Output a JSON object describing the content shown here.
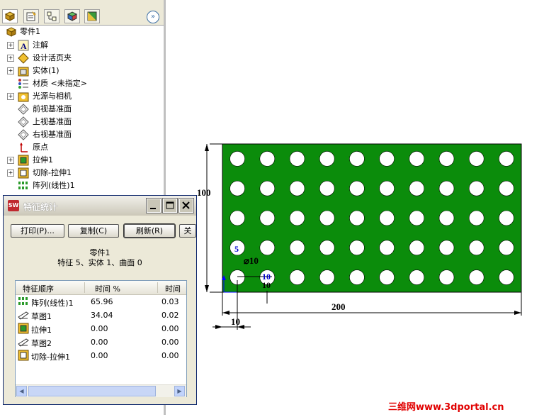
{
  "feature_tree": {
    "root": "零件1",
    "items": [
      {
        "label": "注解",
        "icon": "annotations-icon",
        "expandable": true
      },
      {
        "label": "设计活页夹",
        "icon": "design-binder-icon",
        "expandable": true
      },
      {
        "label": "实体(1)",
        "icon": "solid-bodies-icon",
        "expandable": true
      },
      {
        "label": "材质 <未指定>",
        "icon": "material-icon",
        "expandable": false
      },
      {
        "label": "光源与相机",
        "icon": "lights-cameras-icon",
        "expandable": true
      },
      {
        "label": "前视基准面",
        "icon": "plane-icon",
        "expandable": false
      },
      {
        "label": "上视基准面",
        "icon": "plane-icon",
        "expandable": false
      },
      {
        "label": "右视基准面",
        "icon": "plane-icon",
        "expandable": false
      },
      {
        "label": "原点",
        "icon": "origin-icon",
        "expandable": false
      },
      {
        "label": "拉伸1",
        "icon": "extrude-icon",
        "expandable": true
      },
      {
        "label": "切除-拉伸1",
        "icon": "cut-extrude-icon",
        "expandable": true
      },
      {
        "label": "阵列(线性)1",
        "icon": "linear-pattern-icon",
        "expandable": false
      }
    ]
  },
  "dialog": {
    "title": "特征统计",
    "buttons": {
      "print": "打印(P)...",
      "copy": "复制(C)",
      "refresh": "刷新(R)",
      "close": "关"
    },
    "summary_name": "零件1",
    "summary_stats": "特征 5、实体 1、曲面 0",
    "columns": [
      "特征顺序",
      "时间 %",
      "时间"
    ],
    "rows": [
      {
        "name": "阵列(线性)1",
        "pct": "65.96",
        "time": "0.03",
        "icon": "linear-pattern-icon"
      },
      {
        "name": "草图1",
        "pct": "34.04",
        "time": "0.02",
        "icon": "sketch-icon"
      },
      {
        "name": "拉伸1",
        "pct": "0.00",
        "time": "0.00",
        "icon": "extrude-icon"
      },
      {
        "name": "草图2",
        "pct": "0.00",
        "time": "0.00",
        "icon": "sketch-icon"
      },
      {
        "name": "切除-拉伸1",
        "pct": "0.00",
        "time": "0.00",
        "icon": "cut-extrude-icon"
      }
    ]
  },
  "drawing": {
    "plate_color": "#0b8c0b",
    "hole_rows": 5,
    "hole_cols": 10,
    "dims": {
      "height": "100",
      "width": "200",
      "offset": "10",
      "diameter": "⌀10",
      "ten_a": "10",
      "ten_b": "10",
      "count": "5"
    }
  },
  "watermark": "三维网www.3dportal.cn"
}
